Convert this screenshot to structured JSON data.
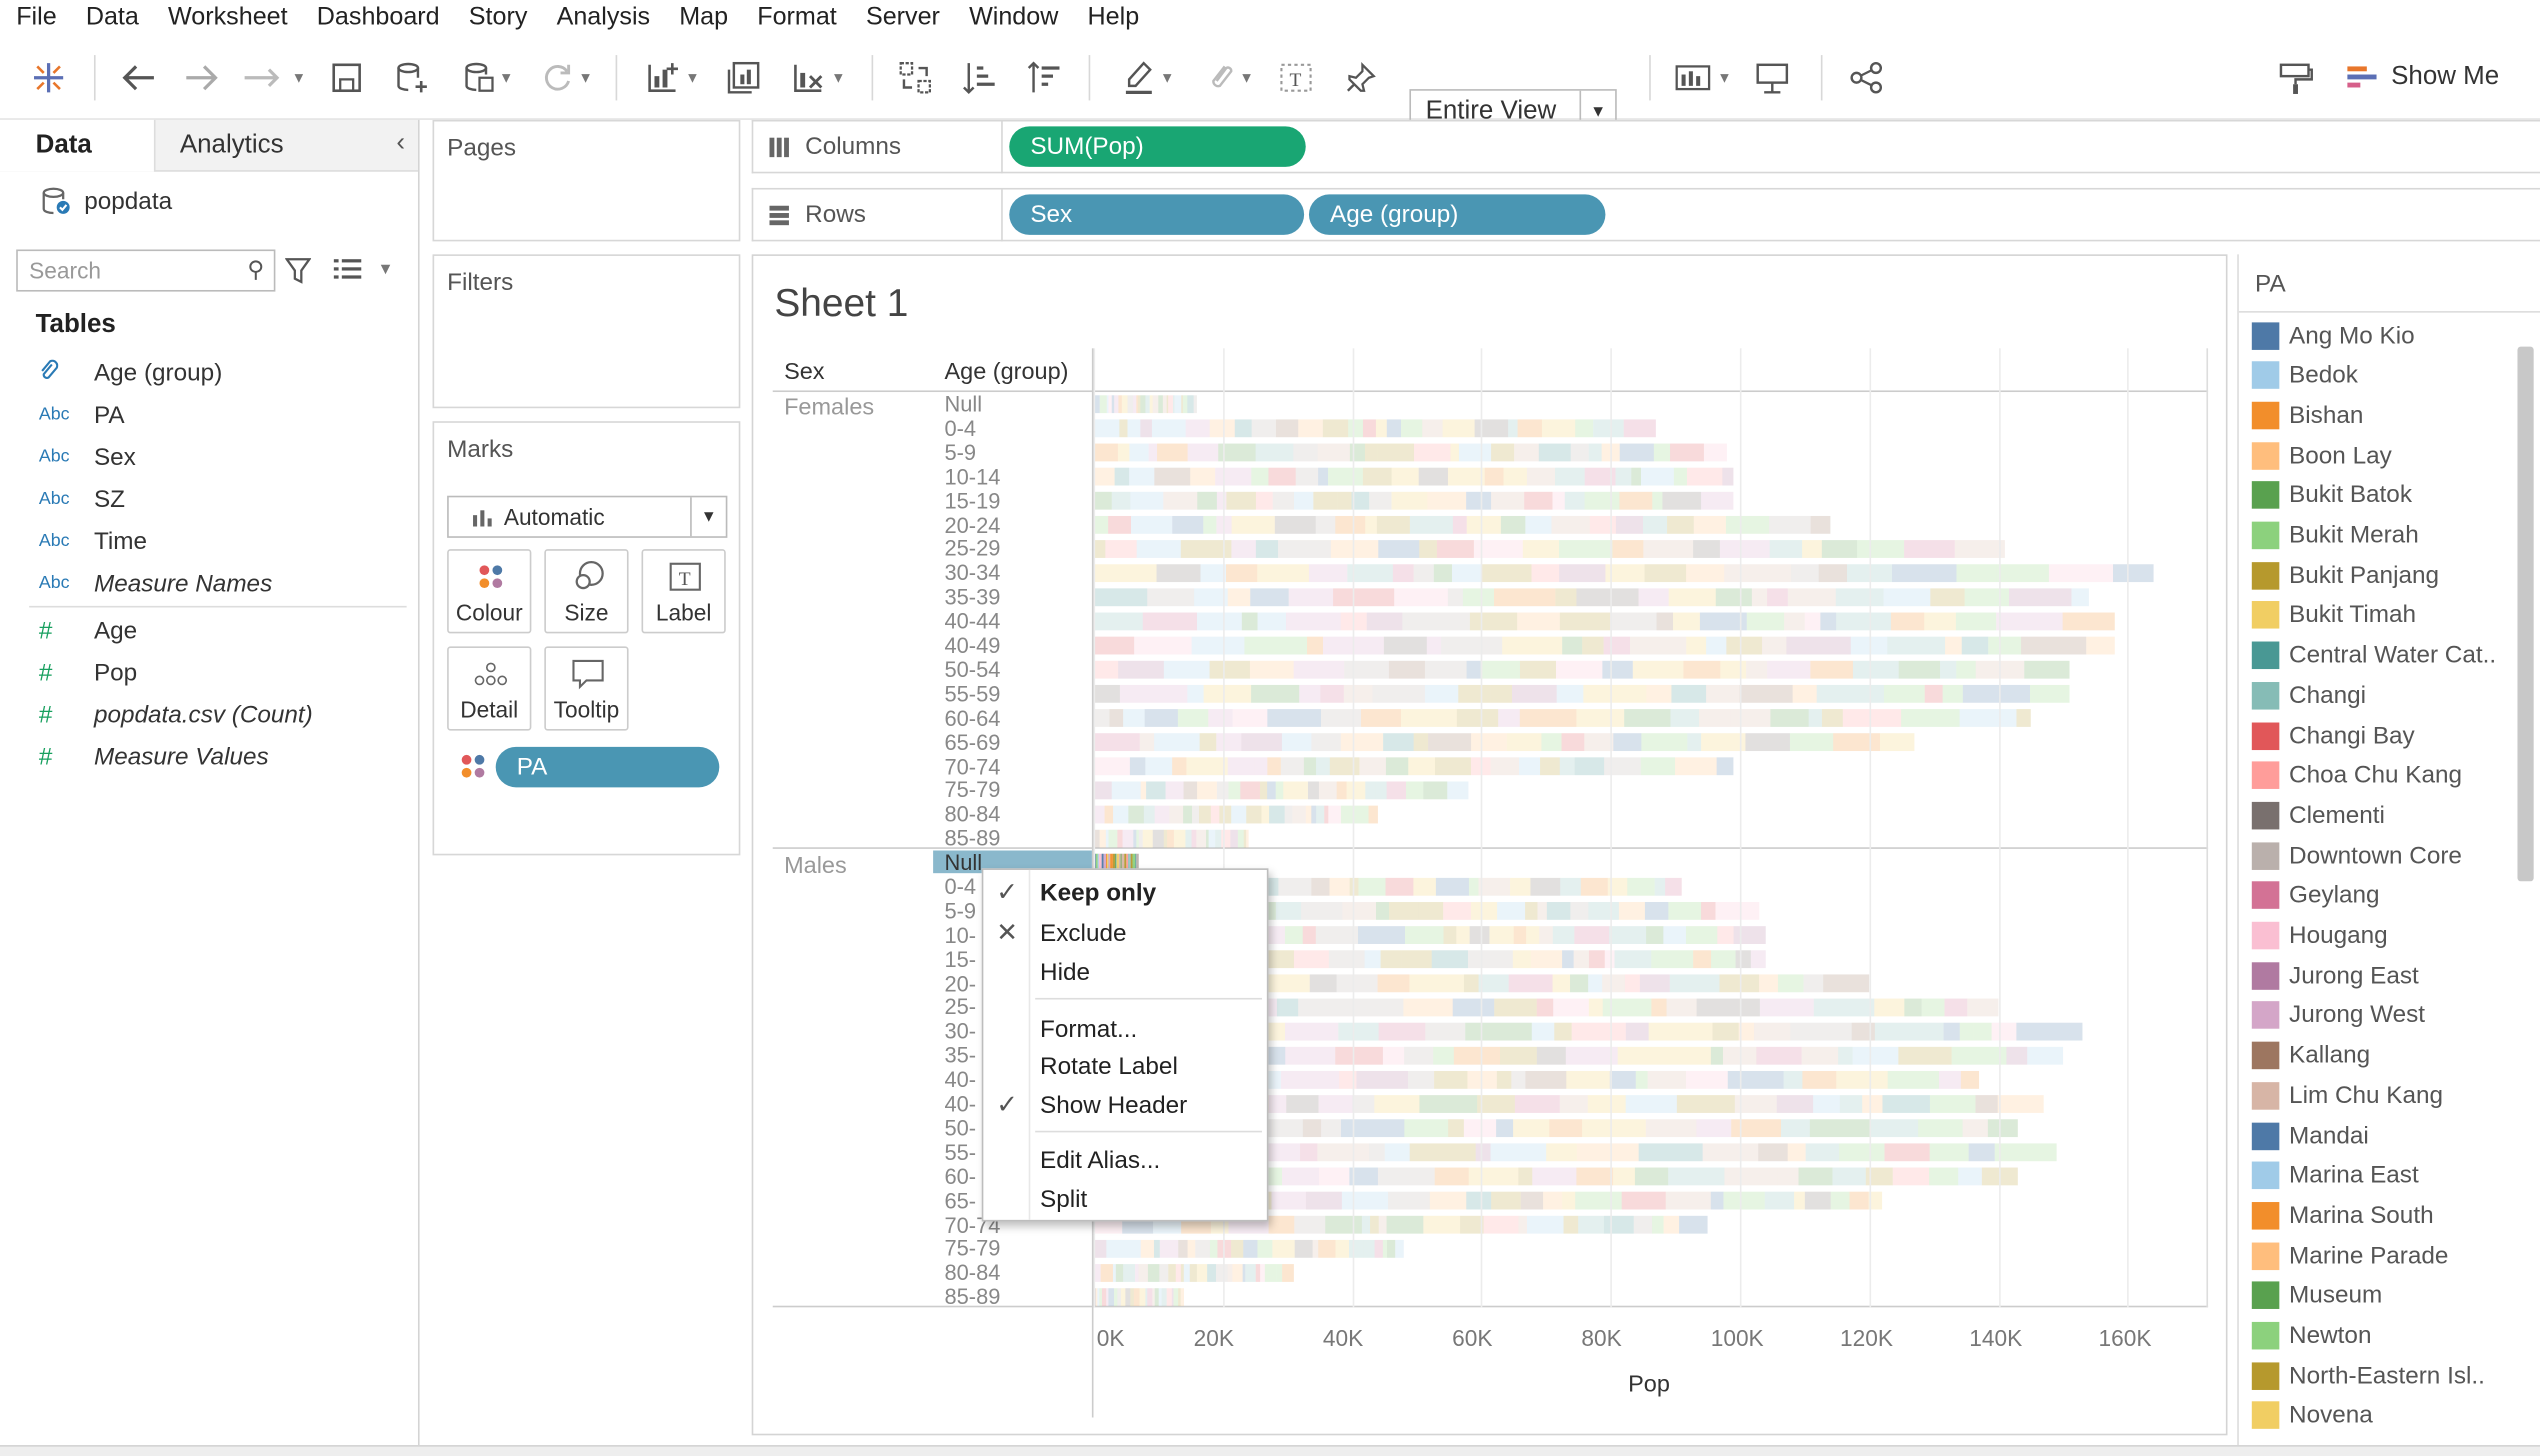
{
  "menu": [
    "File",
    "Data",
    "Worksheet",
    "Dashboard",
    "Story",
    "Analysis",
    "Map",
    "Format",
    "Server",
    "Window",
    "Help"
  ],
  "toolbar": {
    "fit": "Entire View",
    "show_me": "Show Me"
  },
  "data_pane": {
    "tabs": [
      "Data",
      "Analytics"
    ],
    "datasource": "popdata",
    "search_placeholder": "Search",
    "tables_heading": "Tables",
    "dimensions": [
      {
        "icon": "paperclip-icon",
        "name": "Age (group)",
        "italic": false
      },
      {
        "icon": "Abc",
        "name": "PA",
        "italic": false
      },
      {
        "icon": "Abc",
        "name": "Sex",
        "italic": false
      },
      {
        "icon": "Abc",
        "name": "SZ",
        "italic": false
      },
      {
        "icon": "Abc",
        "name": "Time",
        "italic": false
      },
      {
        "icon": "Abc",
        "name": "Measure Names",
        "italic": true
      }
    ],
    "measures": [
      {
        "icon": "#",
        "name": "Age",
        "italic": false
      },
      {
        "icon": "#",
        "name": "Pop",
        "italic": false
      },
      {
        "icon": "#",
        "name": "popdata.csv (Count)",
        "italic": true
      },
      {
        "icon": "#",
        "name": "Measure Values",
        "italic": true
      }
    ]
  },
  "cards": {
    "pages": "Pages",
    "filters": "Filters",
    "marks": "Marks",
    "mark_type": "Automatic",
    "mark_buttons": [
      "Colour",
      "Size",
      "Label",
      "Detail",
      "Tooltip"
    ],
    "mark_pill": "PA"
  },
  "shelves": {
    "columns_label": "Columns",
    "rows_label": "Rows",
    "columns_pills": [
      "SUM(Pop)"
    ],
    "rows_pills": [
      "Sex",
      "Age (group)"
    ]
  },
  "view": {
    "sheet_title": "Sheet 1",
    "row_header_1": "Sex",
    "row_header_2": "Age (group)",
    "sex_values": [
      "Females",
      "Males"
    ],
    "age_groups": [
      "Null",
      "0-4",
      "5-9",
      "10-14",
      "15-19",
      "20-24",
      "25-29",
      "30-34",
      "35-39",
      "40-44",
      "40-49",
      "50-54",
      "55-59",
      "60-64",
      "65-69",
      "70-74",
      "75-79",
      "80-84",
      "85-89"
    ],
    "males_age_labels_visible": [
      "Null",
      "0-4",
      "5-9",
      "10-",
      "15-",
      "20-",
      "25-",
      "30-",
      "35-",
      "40-",
      "40-",
      "50-",
      "55-",
      "60-",
      "65-",
      "70-74",
      "75-79",
      "80-84",
      "85-89"
    ],
    "x_axis_title": "Pop",
    "x_ticks": [
      "0K",
      "20K",
      "40K",
      "60K",
      "80K",
      "100K",
      "120K",
      "140K",
      "160K"
    ]
  },
  "chart_data": {
    "type": "bar",
    "stacked": true,
    "orientation": "horizontal",
    "xlabel": "Pop",
    "xlim": [
      0,
      170000
    ],
    "rows": [
      "Null",
      "0-4",
      "5-9",
      "10-14",
      "15-19",
      "20-24",
      "25-29",
      "30-34",
      "35-39",
      "40-44",
      "40-49",
      "50-54",
      "55-59",
      "60-64",
      "65-69",
      "70-74",
      "75-79",
      "80-84",
      "85-89"
    ],
    "series": [
      {
        "name": "Females",
        "totals": [
          16000,
          87000,
          98000,
          99000,
          99000,
          114000,
          141000,
          164000,
          154000,
          158000,
          158000,
          151000,
          151000,
          145000,
          127000,
          99000,
          58000,
          44000,
          24000
        ]
      },
      {
        "name": "Males",
        "totals": [
          7000,
          91000,
          103000,
          104000,
          104000,
          120000,
          140000,
          153000,
          150000,
          137000,
          147000,
          143000,
          149000,
          143000,
          122000,
          95000,
          48000,
          31000,
          14000
        ]
      }
    ],
    "color_legend_title": "PA"
  },
  "legend": {
    "title": "PA",
    "items": [
      {
        "name": "Ang Mo Kio",
        "color": "#4e79a7"
      },
      {
        "name": "Bedok",
        "color": "#a0cbe8"
      },
      {
        "name": "Bishan",
        "color": "#f28e2b"
      },
      {
        "name": "Boon Lay",
        "color": "#ffbe7d"
      },
      {
        "name": "Bukit Batok",
        "color": "#59a14f"
      },
      {
        "name": "Bukit Merah",
        "color": "#8cd17d"
      },
      {
        "name": "Bukit Panjang",
        "color": "#b6992d"
      },
      {
        "name": "Bukit Timah",
        "color": "#f1ce63"
      },
      {
        "name": "Central Water Cat..",
        "color": "#499894"
      },
      {
        "name": "Changi",
        "color": "#86bcb6"
      },
      {
        "name": "Changi Bay",
        "color": "#e15759"
      },
      {
        "name": "Choa Chu Kang",
        "color": "#ff9d9a"
      },
      {
        "name": "Clementi",
        "color": "#79706e"
      },
      {
        "name": "Downtown Core",
        "color": "#bab0ac"
      },
      {
        "name": "Geylang",
        "color": "#d37295"
      },
      {
        "name": "Hougang",
        "color": "#fabfd2"
      },
      {
        "name": "Jurong East",
        "color": "#b07aa1"
      },
      {
        "name": "Jurong West",
        "color": "#d4a6c8"
      },
      {
        "name": "Kallang",
        "color": "#9d7660"
      },
      {
        "name": "Lim Chu Kang",
        "color": "#d7b5a6"
      },
      {
        "name": "Mandai",
        "color": "#4e79a7"
      },
      {
        "name": "Marina East",
        "color": "#a0cbe8"
      },
      {
        "name": "Marina South",
        "color": "#f28e2b"
      },
      {
        "name": "Marine Parade",
        "color": "#ffbe7d"
      },
      {
        "name": "Museum",
        "color": "#59a14f"
      },
      {
        "name": "Newton",
        "color": "#8cd17d"
      },
      {
        "name": "North-Eastern Isl..",
        "color": "#b6992d"
      },
      {
        "name": "Novena",
        "color": "#f1ce63"
      }
    ]
  },
  "context_menu": {
    "items": [
      {
        "label": "Keep only",
        "mark": "check",
        "bold": true
      },
      {
        "label": "Exclude",
        "mark": "x",
        "bold": false
      },
      {
        "label": "Hide",
        "mark": "",
        "bold": false
      },
      {
        "label": "Format...",
        "mark": "",
        "bold": false
      },
      {
        "label": "Rotate Label",
        "mark": "",
        "bold": false
      },
      {
        "label": "Show Header",
        "mark": "check",
        "bold": false
      },
      {
        "label": "Edit Alias...",
        "mark": "",
        "bold": false
      },
      {
        "label": "Split",
        "mark": "",
        "bold": false
      }
    ]
  }
}
